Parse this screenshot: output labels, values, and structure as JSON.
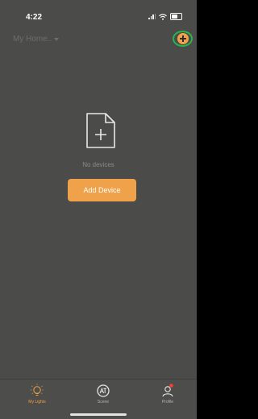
{
  "status_bar": {
    "time": "4:22"
  },
  "header": {
    "home_name": "My Home.."
  },
  "main": {
    "empty_text": "No devices",
    "add_device_label": "Add Device"
  },
  "tabs": [
    {
      "label": "My Lights",
      "icon": "bulb-icon",
      "active": true
    },
    {
      "label": "Scene",
      "icon": "scene-icon",
      "active": false
    },
    {
      "label": "Profile",
      "icon": "profile-icon",
      "active": false
    }
  ],
  "colors": {
    "accent": "#f0a24a",
    "background": "#4b4b49",
    "highlight_ring": "#28b34b",
    "badge": "#ff3b30"
  }
}
